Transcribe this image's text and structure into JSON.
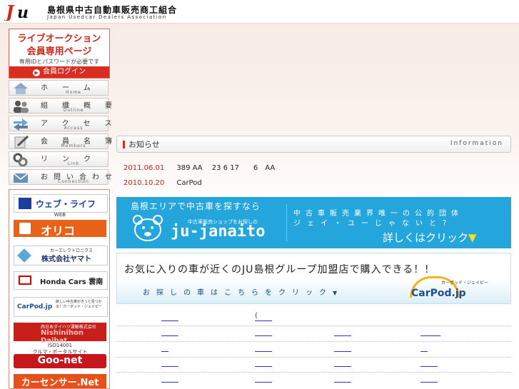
{
  "header": {
    "org_name_jp": "島根県中古自動車販売商工組合",
    "org_name_en": "Japan Usedcar Dealers Association",
    "logo_text": "JU"
  },
  "auction": {
    "title_line1": "ライブオークション",
    "title_line2": "会員専用ページ",
    "note": "専用IDとパスワードが必要です",
    "login_label": "会員ログイン"
  },
  "nav": [
    {
      "label": "ホーム",
      "sub": "Home",
      "icon": "house-icon"
    },
    {
      "label": "組織概要",
      "sub": "Outline",
      "icon": "people-icon"
    },
    {
      "label": "アクセス",
      "sub": "Access",
      "icon": "arrows-icon"
    },
    {
      "label": "会員名簿",
      "sub": "Members",
      "icon": "pencil-icon"
    },
    {
      "label": "リンク",
      "sub": "Link",
      "icon": "chain-link-icon"
    },
    {
      "label": "お問い合わせ",
      "sub": "Connection",
      "icon": "envelope-icon"
    }
  ],
  "partners": {
    "weblife": "ウェブ・ライフ",
    "weblife_sub": "WEB",
    "orico": "オリコ",
    "yamato_sub": "カーエレクトロニクス",
    "yamato": "株式会社ヤマト",
    "honda": "Honda Cars 雲南",
    "carpod_note": "欲しい中古車がきっと見つかる！カーポッド・ジェイピー",
    "nishinihon_top": "西日本ダイハツ運輸株式会社",
    "nishinihon": "Nishinihon Daihat",
    "goonet_top1": "ISO14001",
    "goonet_top2": "クルマ・ポータルサイト",
    "goonet": "Goo-net",
    "carsensor": "カーセンサー.Net"
  },
  "info": {
    "title": "お知らせ",
    "title_en": "Information",
    "news": [
      {
        "date": "2011.06.01",
        "text": "389 AA　 23 6 17　　6　AA"
      },
      {
        "date": "2010.10.20",
        "text": "CarPod"
      }
    ]
  },
  "janaito": {
    "headline": "島根エリアで中古車を探すなら",
    "logo": "ju-janaito",
    "logo_sub": "中古車販売ショップをお探しの",
    "tagline1": "中古車販売業界唯一の公的団体",
    "tagline2": "ジェイ・ユーじゃないと？",
    "cta": "詳しくはクリック"
  },
  "carpod": {
    "headline": "お気に入りの車が近くのJU島根グループ加盟店で購入できる！！",
    "cta": "お探しの車はこちらをクリック",
    "logo": "CarPod.jp",
    "logo_sub": "カーポッド・ジェイピー"
  },
  "links_row0": [
    "",
    "("
  ]
}
